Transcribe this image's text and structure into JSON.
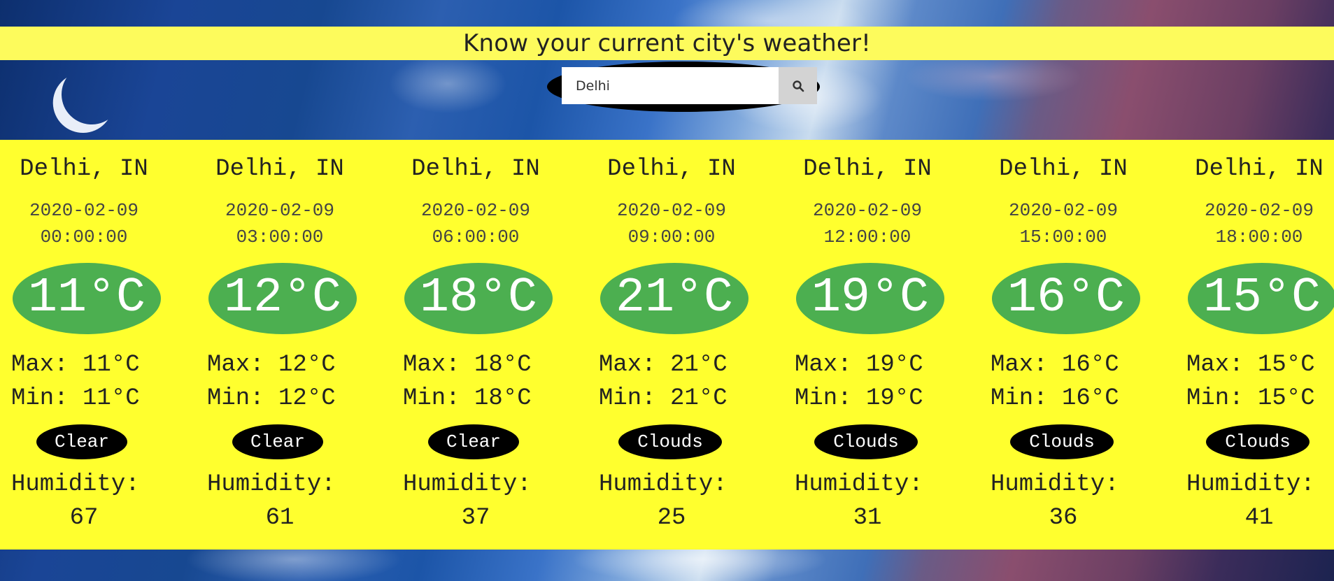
{
  "header": {
    "title": "Know your current city's weather!"
  },
  "search": {
    "value": "Delhi",
    "button_icon": "search-icon"
  },
  "forecast": [
    {
      "city": "Delhi, IN",
      "date": "2020-02-09",
      "time": "00:00:00",
      "temp": "11°C",
      "max": "Max: 11°C",
      "min": "Min: 11°C",
      "condition": "Clear",
      "humidity_label": "Humidity:",
      "humidity": "67"
    },
    {
      "city": "Delhi, IN",
      "date": "2020-02-09",
      "time": "03:00:00",
      "temp": "12°C",
      "max": "Max: 12°C",
      "min": "Min: 12°C",
      "condition": "Clear",
      "humidity_label": "Humidity:",
      "humidity": "61"
    },
    {
      "city": "Delhi, IN",
      "date": "2020-02-09",
      "time": "06:00:00",
      "temp": "18°C",
      "max": "Max: 18°C",
      "min": "Min: 18°C",
      "condition": "Clear",
      "humidity_label": "Humidity:",
      "humidity": "37"
    },
    {
      "city": "Delhi, IN",
      "date": "2020-02-09",
      "time": "09:00:00",
      "temp": "21°C",
      "max": "Max: 21°C",
      "min": "Min: 21°C",
      "condition": "Clouds",
      "humidity_label": "Humidity:",
      "humidity": "25"
    },
    {
      "city": "Delhi, IN",
      "date": "2020-02-09",
      "time": "12:00:00",
      "temp": "19°C",
      "max": "Max: 19°C",
      "min": "Min: 19°C",
      "condition": "Clouds",
      "humidity_label": "Humidity:",
      "humidity": "31"
    },
    {
      "city": "Delhi, IN",
      "date": "2020-02-09",
      "time": "15:00:00",
      "temp": "16°C",
      "max": "Max: 16°C",
      "min": "Min: 16°C",
      "condition": "Clouds",
      "humidity_label": "Humidity:",
      "humidity": "36"
    },
    {
      "city": "Delhi, IN",
      "date": "2020-02-09",
      "time": "18:00:00",
      "temp": "15°C",
      "max": "Max: 15°C",
      "min": "Min: 15°C",
      "condition": "Clouds",
      "humidity_label": "Humidity:",
      "humidity": "41"
    }
  ],
  "colors": {
    "header_band": "#fdfb5c",
    "forecast_band": "#ffff2e",
    "temp_badge": "#4caf50",
    "condition_badge": "#000000"
  }
}
